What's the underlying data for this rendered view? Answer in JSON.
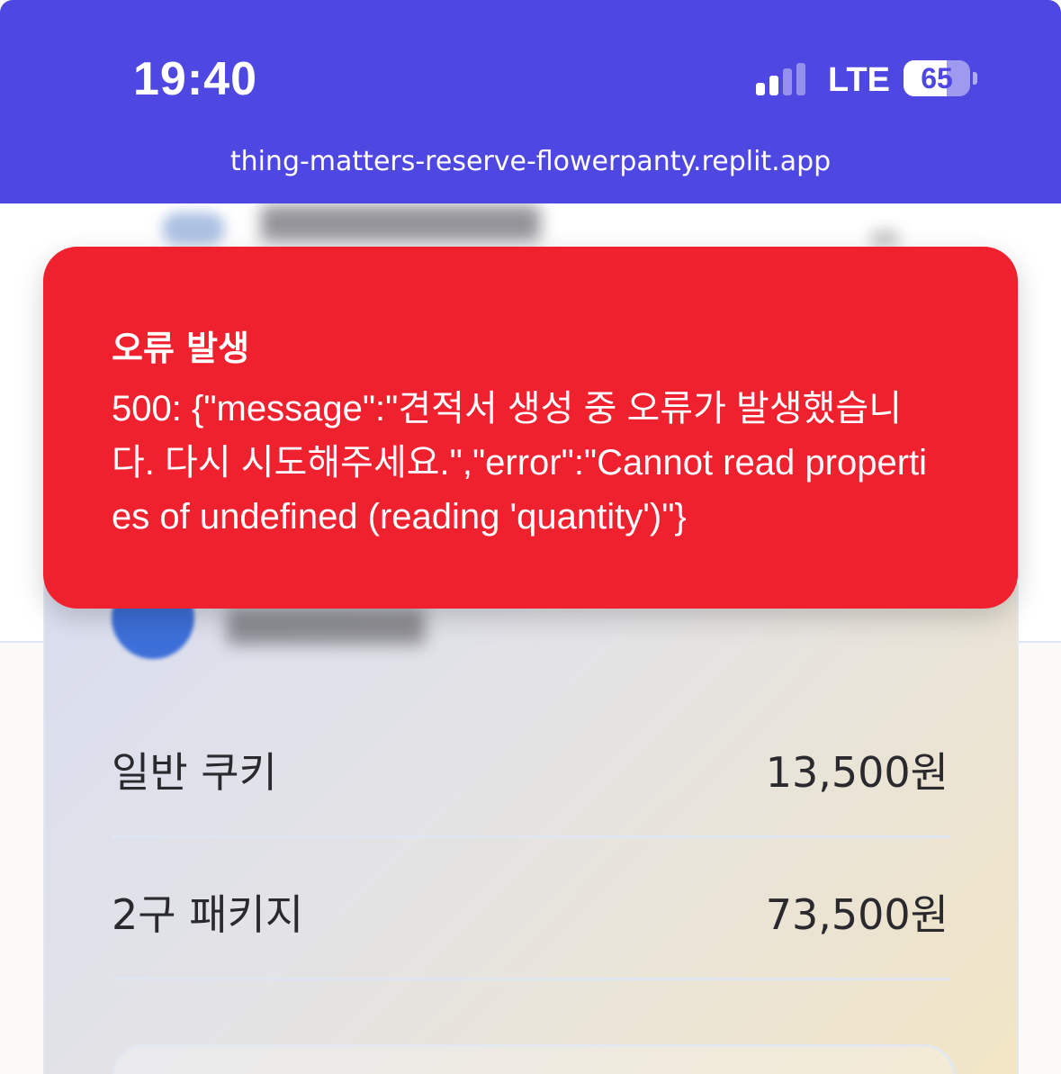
{
  "status_bar": {
    "time": "19:40",
    "network": "LTE",
    "battery_level": "65",
    "battery_fraction": 0.65,
    "signal_bars_active": 2,
    "signal_bars_total": 4
  },
  "browser": {
    "url": "thing-matters-reserve-flowerpanty.replit.app"
  },
  "toast": {
    "title": "오류 발생",
    "message": "500: {\"message\":\"견적서 생성 중 오류가 발생했습니다. 다시 시도해주세요.\",\"error\":\"Cannot read properties of undefined (reading 'quantity')\"}"
  },
  "price_list": [
    {
      "name": "일반 쿠키",
      "price": "13,500원"
    },
    {
      "name": "2구 패키지",
      "price": "73,500원"
    }
  ],
  "colors": {
    "status_bar_bg": "#4f47e2",
    "toast_bg": "#f0212f",
    "avatar": "#3d6fd8"
  }
}
